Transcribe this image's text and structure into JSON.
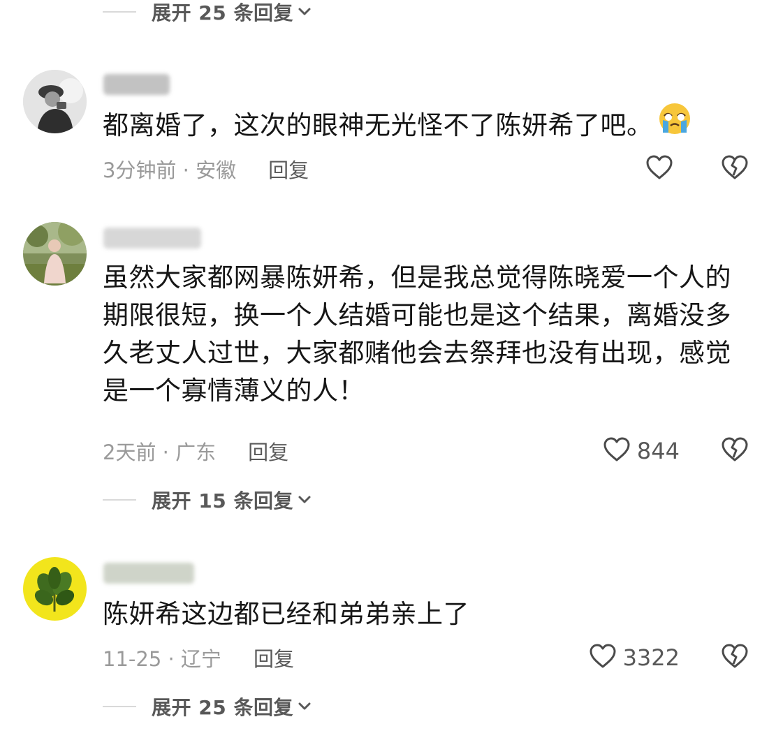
{
  "top_expand": {
    "label": "展开 25 条回复"
  },
  "comments": [
    {
      "content": "都离婚了，这次的眼神无光怪不了陈妍希了吧。",
      "time_location": "3分钟前 · 安徽",
      "reply_label": "回复",
      "like_count": ""
    },
    {
      "content": "虽然大家都网暴陈妍希，但是我总觉得陈晓爱一个人的期限很短，换一个人结婚可能也是这个结果，离婚没多久老丈人过世，大家都赌他会去祭拜也没有出现，感觉是一个寡情薄义的人！",
      "time_location": "2天前 · 广东",
      "reply_label": "回复",
      "like_count": "844",
      "expand_label": "展开 15 条回复"
    },
    {
      "content": "陈妍希这边都已经和弟弟亲上了",
      "time_location": "11-25 · 辽宁",
      "reply_label": "回复",
      "like_count": "3322",
      "expand_label": "展开 25 条回复"
    }
  ],
  "icons": {
    "like": "heart-outline-icon",
    "dislike": "broken-heart-icon",
    "chevron": "chevron-down-icon",
    "emoji": "crying-face-emoji"
  },
  "colors": {
    "text": "#161616",
    "meta": "#9a9a9a",
    "secondary": "#585858",
    "emoji": "#f7c63a"
  }
}
